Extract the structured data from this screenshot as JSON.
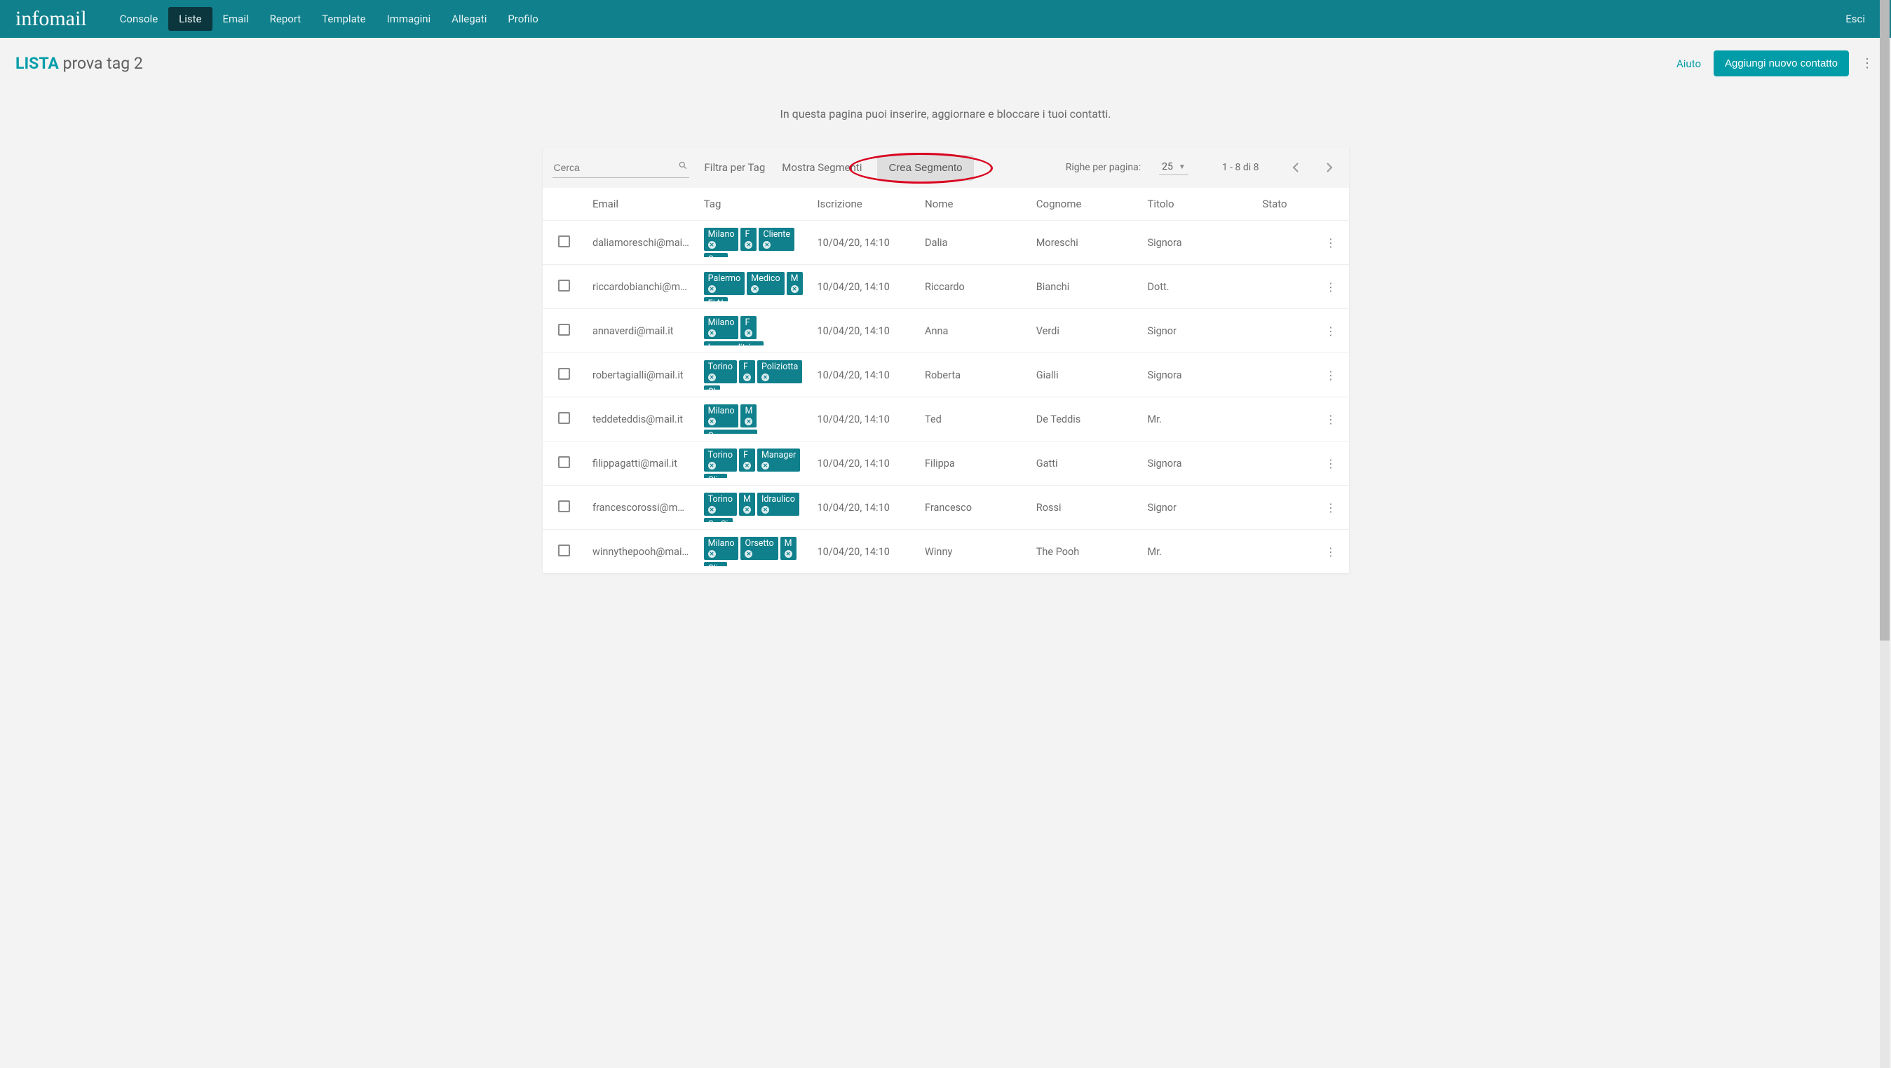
{
  "nav": {
    "logo": "infomail",
    "items": [
      "Console",
      "Liste",
      "Email",
      "Report",
      "Template",
      "Immagini",
      "Allegati",
      "Profilo"
    ],
    "active_index": 1,
    "exit": "Esci"
  },
  "header": {
    "title_strong": "LISTA",
    "title_rest": "prova tag 2",
    "help": "Aiuto",
    "add_button": "Aggiungi nuovo contatto"
  },
  "subtitle": "In questa pagina puoi inserire, aggiornare e bloccare i tuoi contatti.",
  "toolbar": {
    "search_placeholder": "Cerca",
    "filter_tag": "Filtra per Tag",
    "show_segments": "Mostra Segmenti",
    "create_segment": "Crea Segmento",
    "rows_per_page_label": "Righe per pagina:",
    "rows_per_page_value": "25",
    "page_info": "1 - 8 di 8"
  },
  "columns": {
    "email": "Email",
    "tag": "Tag",
    "iscrizione": "Iscrizione",
    "nome": "Nome",
    "cognome": "Cognome",
    "titolo": "Titolo",
    "stato": "Stato"
  },
  "rows": [
    {
      "email": "daliamoreschi@mail.it",
      "tags": [
        "Milano",
        "F",
        "Cliente",
        "Con"
      ],
      "date": "10/04/20, 14:10",
      "nome": "Dalia",
      "cognome": "Moreschi",
      "titolo": "Signora"
    },
    {
      "email": "riccardobianchi@mail.it",
      "tags": [
        "Palermo",
        "Medico",
        "M",
        "Fi N"
      ],
      "date": "10/04/20, 14:10",
      "nome": "Riccardo",
      "cognome": "Bianchi",
      "titolo": "Dott."
    },
    {
      "email": "annaverdi@mail.it",
      "tags": [
        "Milano",
        "F",
        "Imprenditrice"
      ],
      "date": "10/04/20, 14:10",
      "nome": "Anna",
      "cognome": "Verdi",
      "titolo": "Signor"
    },
    {
      "email": "robertagialli@mail.it",
      "tags": [
        "Torino",
        "F",
        "Poliziotta",
        "Cl"
      ],
      "date": "10/04/20, 14:10",
      "nome": "Roberta",
      "cognome": "Gialli",
      "titolo": "Signora"
    },
    {
      "email": "teddeteddis@mail.it",
      "tags": [
        "Milano",
        "M",
        "Commesso"
      ],
      "date": "10/04/20, 14:10",
      "nome": "Ted",
      "cognome": "De Teddis",
      "titolo": "Mr."
    },
    {
      "email": "filippagatti@mail.it",
      "tags": [
        "Torino",
        "F",
        "Manager",
        "Clie"
      ],
      "date": "10/04/20, 14:10",
      "nome": "Filippa",
      "cognome": "Gatti",
      "titolo": "Signora"
    },
    {
      "email": "francescorossi@mail.it",
      "tags": [
        "Torino",
        "M",
        "Idraulico",
        "Ga Si"
      ],
      "date": "10/04/20, 14:10",
      "nome": "Francesco",
      "cognome": "Rossi",
      "titolo": "Signor"
    },
    {
      "email": "winnythepooh@mail.it",
      "tags": [
        "Milano",
        "Orsetto",
        "M",
        "Clie"
      ],
      "date": "10/04/20, 14:10",
      "nome": "Winny",
      "cognome": "The Pooh",
      "titolo": "Mr."
    }
  ]
}
